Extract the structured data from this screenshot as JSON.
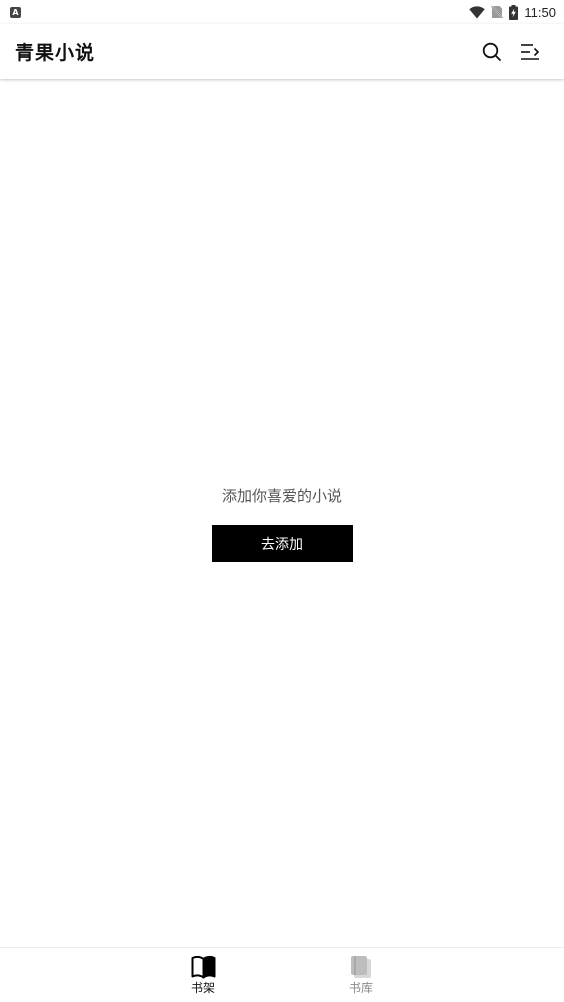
{
  "status_bar": {
    "notification_icon": "A",
    "time": "11:50",
    "icons": [
      "wifi-icon",
      "no-sim-icon",
      "battery-charging-icon"
    ]
  },
  "app_bar": {
    "title": "青果小说",
    "actions": [
      "search-icon",
      "menu-arrow-icon"
    ]
  },
  "empty_state": {
    "message": "添加你喜爱的小说",
    "button_label": "去添加"
  },
  "bottom_nav": {
    "items": [
      {
        "label": "书架",
        "icon": "open-book-icon",
        "active": true
      },
      {
        "label": "书库",
        "icon": "book-stack-icon",
        "active": false
      }
    ]
  },
  "colors": {
    "primary": "#000000",
    "background": "#ffffff",
    "inactive": "#8a8a8a",
    "muted_text": "#555555"
  }
}
